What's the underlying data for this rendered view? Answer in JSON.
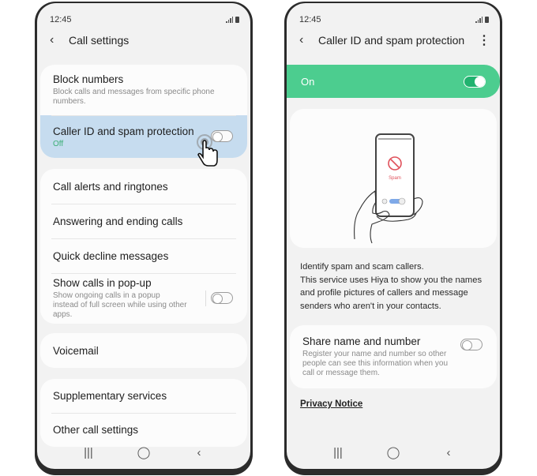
{
  "left_phone": {
    "status": {
      "time": "12:45",
      "signal_icon": "signal-icon",
      "battery_icon": "battery-icon"
    },
    "appbar": {
      "back_icon": "‹",
      "title": "Call settings"
    },
    "group1": [
      {
        "title": "Block numbers",
        "subtitle": "Block calls and messages from specific phone numbers."
      },
      {
        "title": "Caller ID and spam protection",
        "status": "Off",
        "toggle": "off",
        "highlighted": true
      }
    ],
    "group2": [
      {
        "title": "Call alerts and ringtones"
      },
      {
        "title": "Answering and ending calls"
      },
      {
        "title": "Quick decline messages"
      },
      {
        "title": "Show calls in pop-up",
        "subtitle": "Show ongoing calls in a popup instead of full screen while using other apps.",
        "toggle": "off"
      }
    ],
    "group3": [
      {
        "title": "Voicemail"
      }
    ],
    "group4": [
      {
        "title": "Supplementary services"
      },
      {
        "title": "Other call settings"
      }
    ],
    "navbar": {
      "recents": "|||",
      "home": "◯",
      "back": "‹"
    }
  },
  "right_phone": {
    "status": {
      "time": "12:45"
    },
    "appbar": {
      "back_icon": "‹",
      "title": "Caller ID and spam protection",
      "more_icon": "⋮"
    },
    "master_switch": {
      "label": "On",
      "state": "on"
    },
    "illustration": {
      "spam_label": "Spam"
    },
    "description": [
      "Identify spam and scam callers.",
      "This service uses Hiya to show you the names and profile pictures of callers and message senders who aren't in your contacts."
    ],
    "share": {
      "title": "Share name and number",
      "subtitle": "Register your name and number so other people can see this information when you call or message them.",
      "toggle": "off"
    },
    "privacy_link": "Privacy Notice",
    "navbar": {
      "recents": "|||",
      "home": "◯",
      "back": "‹"
    }
  },
  "colors": {
    "accent_green": "#4ccd8f",
    "highlight_blue": "#c6dcef",
    "status_off_green": "#3daf77",
    "spam_red": "#e0505a"
  }
}
